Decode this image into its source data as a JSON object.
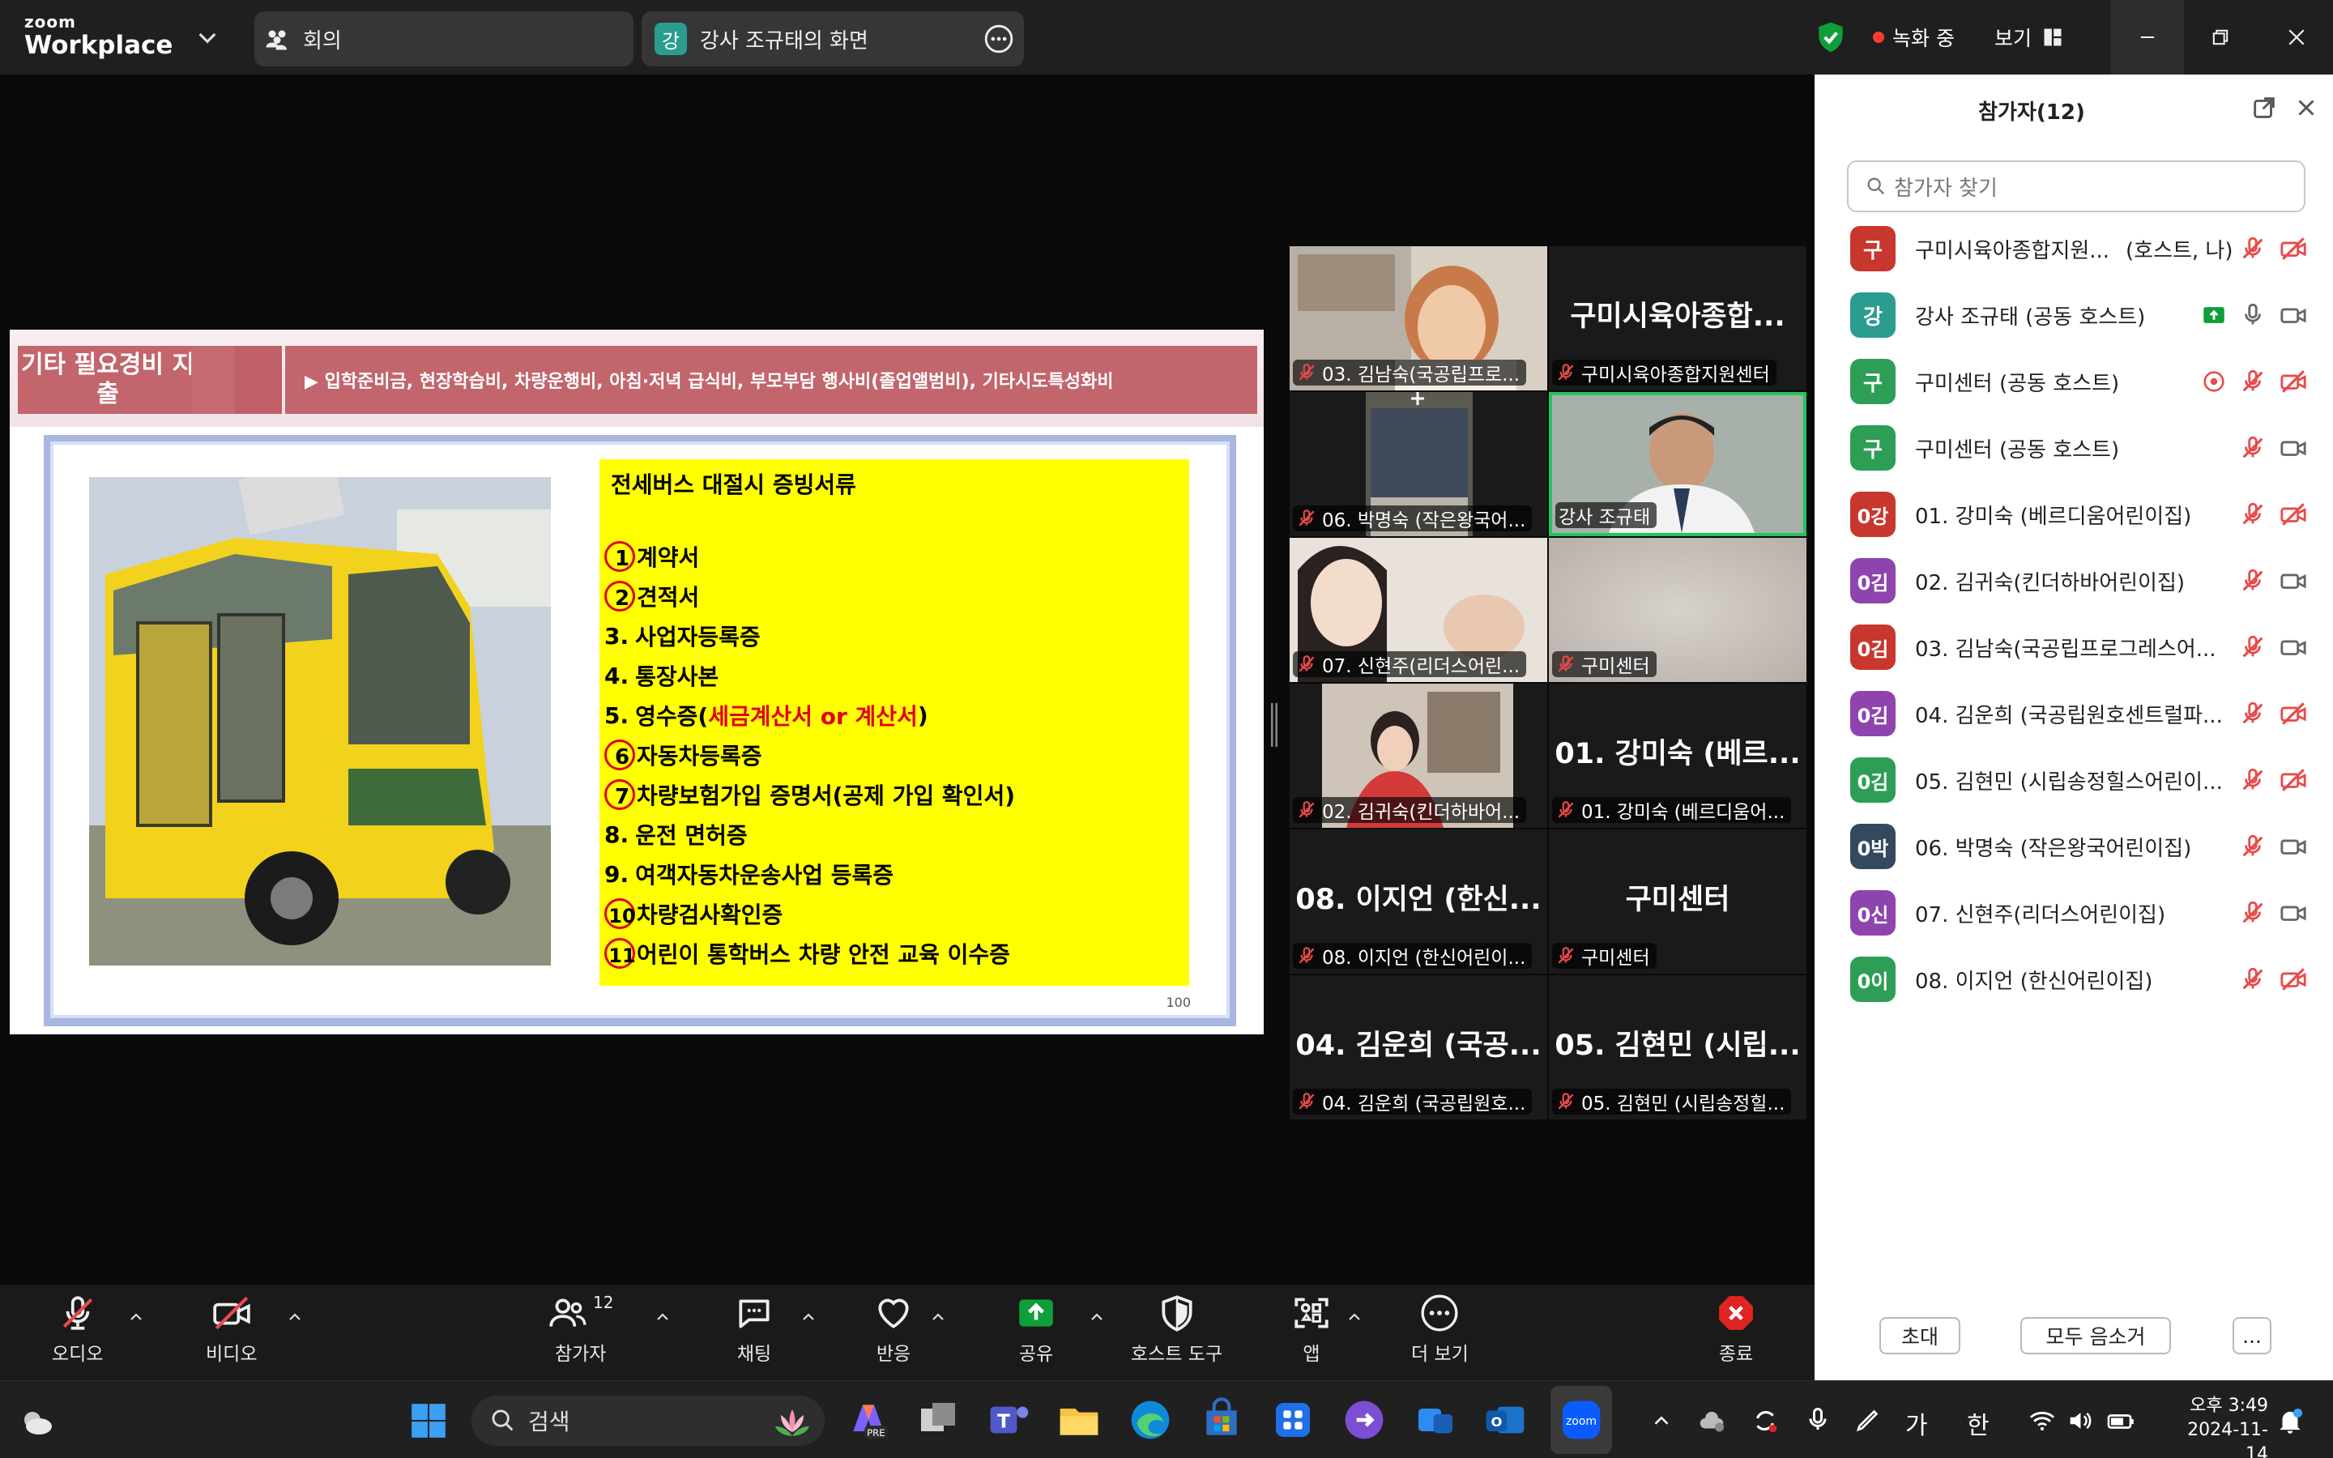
{
  "app": {
    "logo_line1": "zoom",
    "logo_line2": "Workplace",
    "meeting_tab": "회의",
    "share_badge": "강",
    "share_tab": "강사 조규태의 화면",
    "recording": "녹화 중",
    "view": "보기"
  },
  "slide": {
    "header_title": "기타 필요경비 지출",
    "header_bar": "▶ 입학준비금, 현장학습비, 차량운행비, 아침·저녁 급식비, 부모부담 행사비(졸업앨범비), 기타시도특성화비",
    "box_title": "전세버스 대절시 증빙서류",
    "items": [
      {
        "num": "1",
        "text": "계약서"
      },
      {
        "num": "2",
        "text": "견적서"
      },
      {
        "num": "3.",
        "text": "사업자등록증"
      },
      {
        "num": "4.",
        "text": "통장사본"
      },
      {
        "num": "5.",
        "text": "영수증(",
        "red": "세금계산서 or 계산서",
        "after": ")"
      },
      {
        "num": "6",
        "text": "자동차등록증"
      },
      {
        "num": "7",
        "text": "차량보험가입 증명서(공제 가입 확인서)"
      },
      {
        "num": "8.",
        "text": "운전 면허증"
      },
      {
        "num": "9.",
        "text": "여객자동차운송사업 등록증"
      },
      {
        "num": "10",
        "text": "차량검사확인증"
      },
      {
        "num": "11",
        "text": "어린이 통학버스 차량 안전 교육 이수증"
      }
    ],
    "page": "100"
  },
  "gallery": [
    {
      "tag": "03. 김남숙(국공립프로...",
      "big": ""
    },
    {
      "tag": "구미시육아종합지원센터",
      "big": "구미시육아종합..."
    },
    {
      "tag": "06. 박명숙 (작은왕국어...",
      "big": ""
    },
    {
      "tag": "강사 조규태",
      "big": ""
    },
    {
      "tag": "07. 신현주(리더스어린...",
      "big": ""
    },
    {
      "tag": "구미센터",
      "big": ""
    },
    {
      "tag": "02. 김귀숙(킨더하바어...",
      "big": ""
    },
    {
      "tag": "01. 강미숙 (베르디움어...",
      "big": "01. 강미숙 (베르..."
    },
    {
      "tag": "08. 이지언 (한신어린이...",
      "big": "08. 이지언 (한신..."
    },
    {
      "tag": "구미센터",
      "big": "구미센터"
    },
    {
      "tag": "04. 김운희 (국공립원호...",
      "big": "04. 김운희 (국공..."
    },
    {
      "tag": "05. 김현민 (시립송정힐...",
      "big": "05. 김현민 (시립..."
    }
  ],
  "panel": {
    "title": "참가자(12)",
    "search_placeholder": "참가자 찾기",
    "participants": [
      {
        "avatar": "구",
        "color": "#c8372d",
        "name": "구미시육아종합지원...",
        "role": "(호스트, 나)"
      },
      {
        "avatar": "강",
        "color": "#2a9d8f",
        "name": "강사 조규태 (공동 호스트)",
        "role": ""
      },
      {
        "avatar": "구",
        "color": "#2e9e57",
        "name": "구미센터 (공동 호스트)",
        "role": ""
      },
      {
        "avatar": "구",
        "color": "#2e9e57",
        "name": "구미센터 (공동 호스트)",
        "role": ""
      },
      {
        "avatar": "0강",
        "color": "#c8372d",
        "name": "01. 강미숙 (베르디움어린이집)",
        "role": ""
      },
      {
        "avatar": "0김",
        "color": "#8e44ad",
        "name": "02. 김귀숙(킨더하바어린이집)",
        "role": ""
      },
      {
        "avatar": "0김",
        "color": "#c8372d",
        "name": "03. 김남숙(국공립프로그레스어...",
        "role": ""
      },
      {
        "avatar": "0김",
        "color": "#8e44ad",
        "name": "04. 김운희 (국공립원호센트럴파...",
        "role": ""
      },
      {
        "avatar": "0김",
        "color": "#2e9e57",
        "name": "05. 김현민 (시립송정힐스어린이...",
        "role": ""
      },
      {
        "avatar": "0박",
        "color": "#34495e",
        "name": "06. 박명숙 (작은왕국어린이집)",
        "role": ""
      },
      {
        "avatar": "0신",
        "color": "#8e44ad",
        "name": "07. 신현주(리더스어린이집)",
        "role": ""
      },
      {
        "avatar": "0이",
        "color": "#2e9e57",
        "name": "08. 이지언 (한신어린이집)",
        "role": ""
      }
    ],
    "invite": "초대",
    "mute_all": "모두 음소거",
    "more": "..."
  },
  "toolbar": {
    "audio": "오디오",
    "video": "비디오",
    "participants": "참가자",
    "participants_count": "12",
    "chat": "채팅",
    "reactions": "반응",
    "share": "공유",
    "host_tools": "호스트 도구",
    "apps": "앱",
    "more": "더 보기",
    "end": "종료"
  },
  "taskbar": {
    "search": "검색",
    "ime1": "가",
    "ime2": "한",
    "time": "오후 3:49",
    "date": "2024-11-14"
  },
  "colors": {
    "accent_green": "#0e9f3a",
    "recording_red": "#ff3b30",
    "slide_header": "#c2656c",
    "slide_box": "#ffff00",
    "panel_bg": "#ffffff"
  }
}
